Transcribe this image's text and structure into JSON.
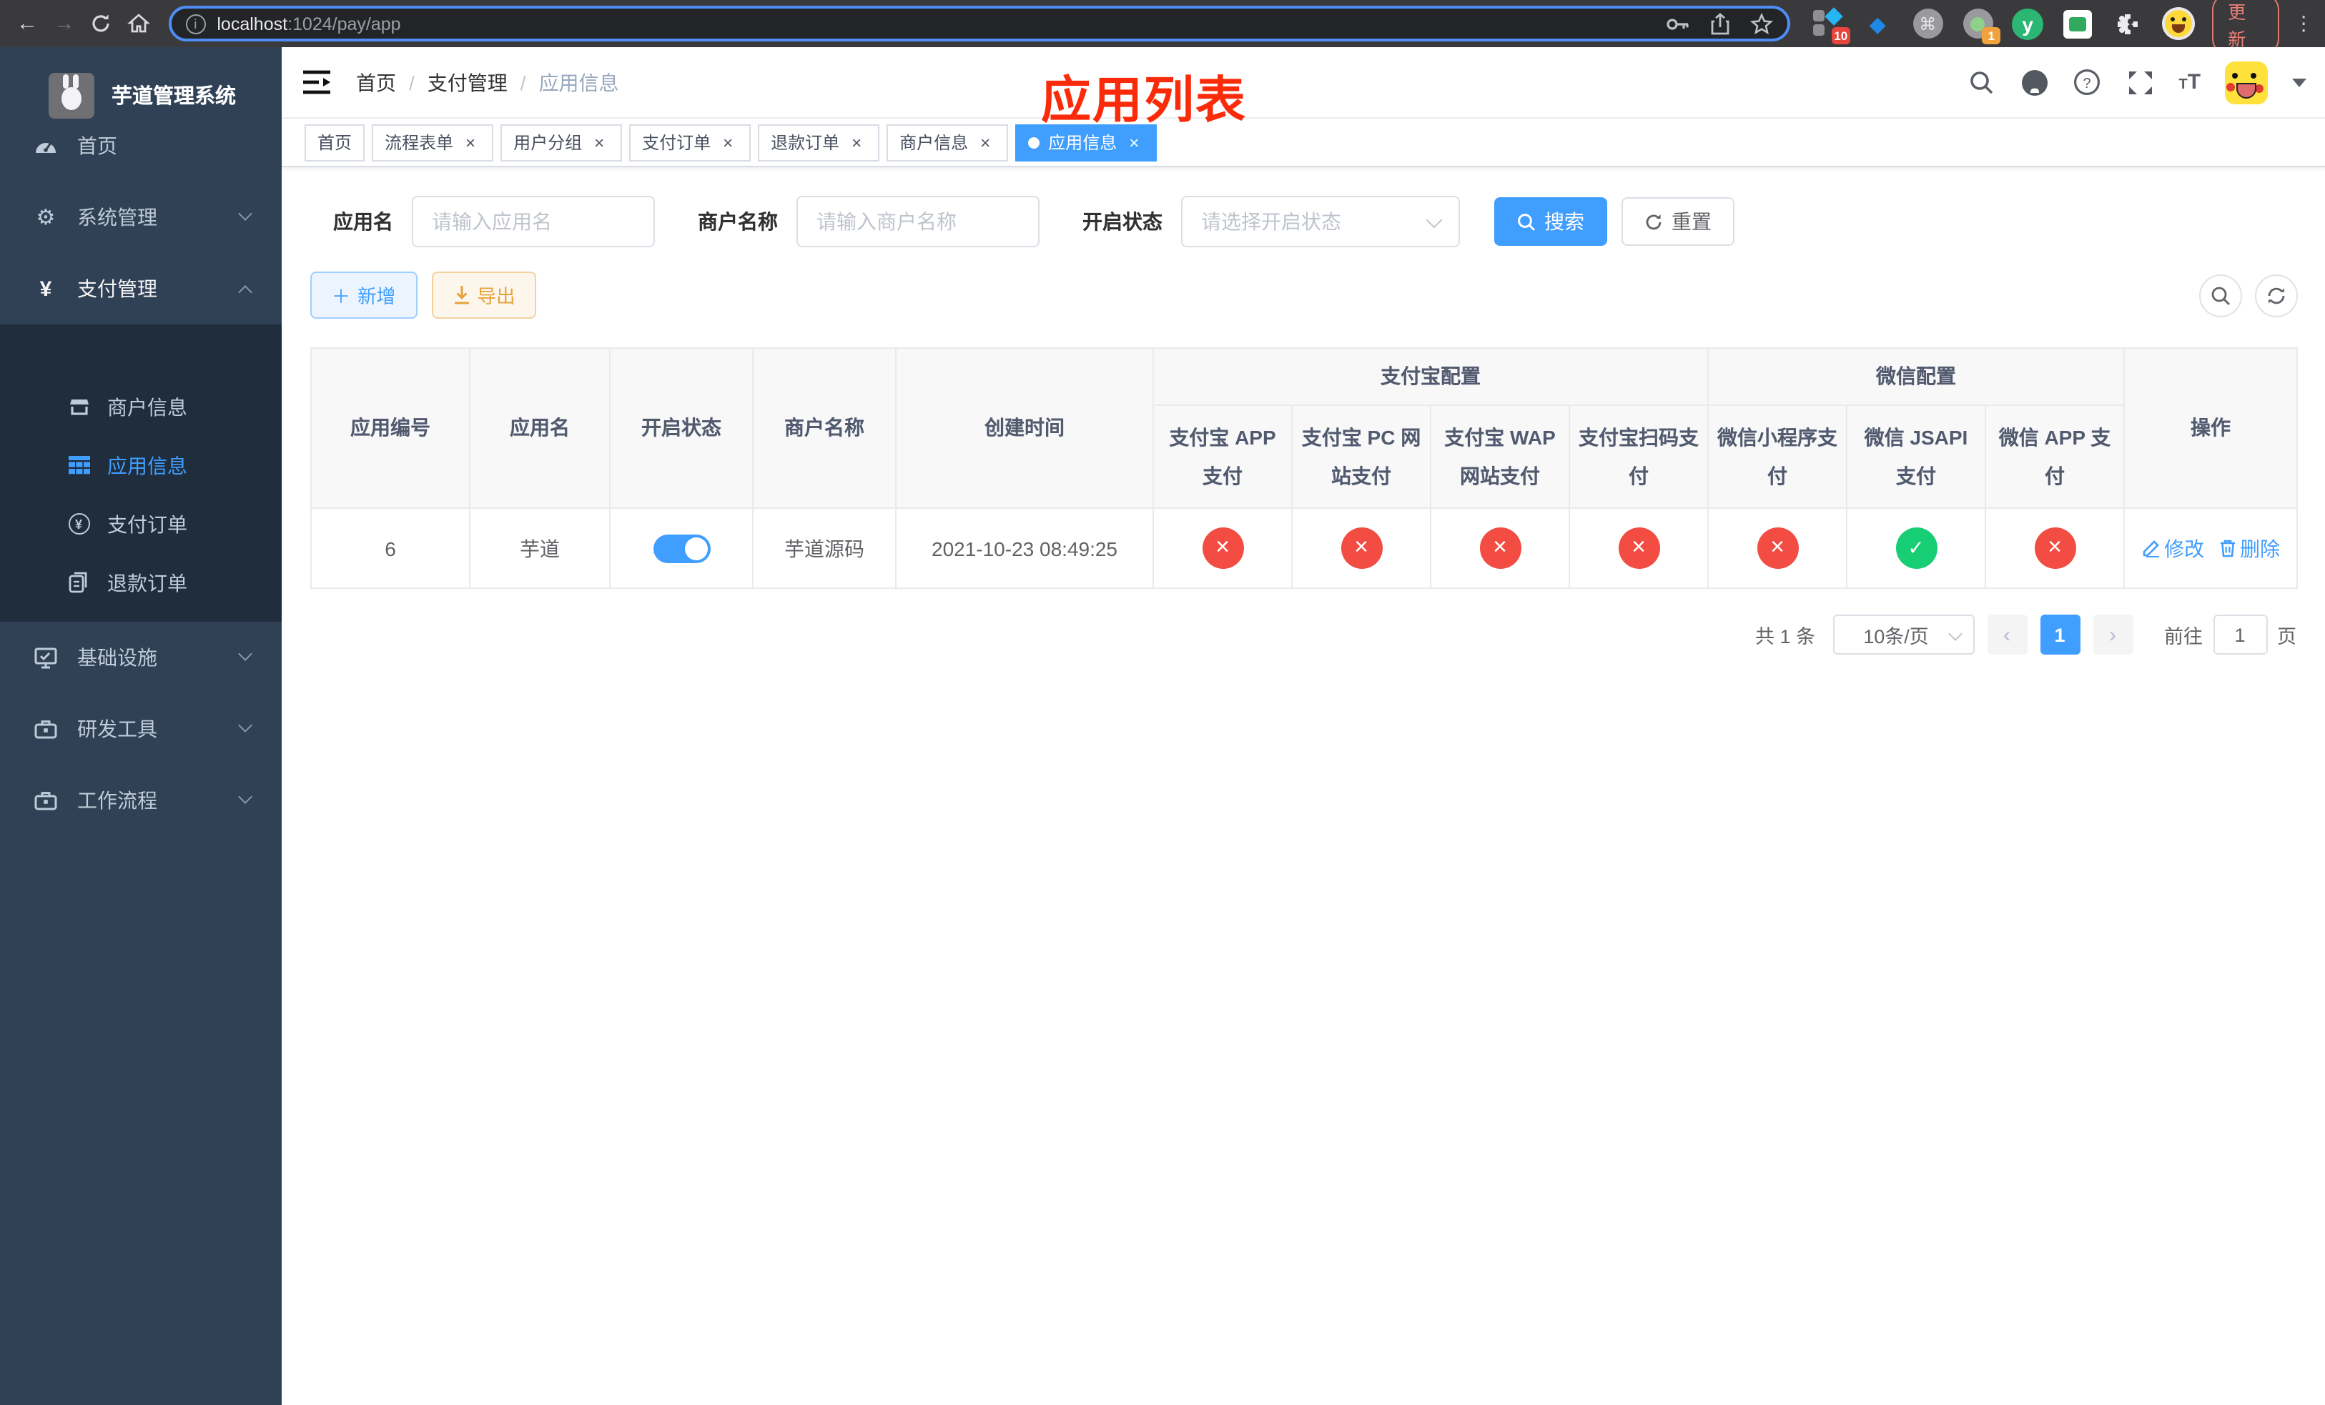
{
  "browser": {
    "url_host": "localhost",
    "url_rest": ":1024/pay/app",
    "update_label": "更新",
    "ext_badge_grid": "10",
    "ext_badge_cam": "1",
    "ext_cmd_glyph": "⌘",
    "ext_y_letter": "y"
  },
  "annotation": {
    "title": "应用列表",
    "color": "#fa2b0a"
  },
  "sidebar": {
    "app_title": "芋道管理系统",
    "items": [
      {
        "label": "首页"
      },
      {
        "label": "系统管理"
      },
      {
        "label": "支付管理"
      },
      {
        "label": "基础设施"
      },
      {
        "label": "研发工具"
      },
      {
        "label": "工作流程"
      }
    ],
    "subitems": [
      {
        "label": "商户信息"
      },
      {
        "label": "应用信息"
      },
      {
        "label": "支付订单"
      },
      {
        "label": "退款订单"
      }
    ]
  },
  "breadcrumb": {
    "items": [
      "首页",
      "支付管理",
      "应用信息"
    ],
    "separator": "/"
  },
  "tabs": [
    {
      "label": "首页"
    },
    {
      "label": "流程表单"
    },
    {
      "label": "用户分组"
    },
    {
      "label": "支付订单"
    },
    {
      "label": "退款订单"
    },
    {
      "label": "商户信息"
    },
    {
      "label": "应用信息"
    }
  ],
  "filters": {
    "app_name_label": "应用名",
    "app_name_placeholder": "请输入应用名",
    "merchant_label": "商户名称",
    "merchant_placeholder": "请输入商户名称",
    "status_label": "开启状态",
    "status_placeholder": "请选择开启状态",
    "search_button": "搜索",
    "reset_button": "重置"
  },
  "toolbar": {
    "add_button": "新增",
    "export_button": "导出"
  },
  "table": {
    "plain_headers": [
      "应用编号",
      "应用名",
      "开启状态",
      "商户名称",
      "创建时间"
    ],
    "group_headers": [
      "支付宝配置",
      "微信配置"
    ],
    "sub_headers": [
      "支付宝 APP 支付",
      "支付宝 PC 网站支付",
      "支付宝 WAP 网站支付",
      "支付宝扫码支付",
      "微信小程序支付",
      "微信 JSAPI 支付",
      "微信 APP 支付"
    ],
    "action_header": "操作",
    "rows": [
      {
        "id": "6",
        "name": "芋道",
        "enabled": "on",
        "merchant": "芋道源码",
        "created": "2021-10-23 08:49:25",
        "statuses": [
          "no",
          "no",
          "no",
          "no",
          "no",
          "yes",
          "no"
        ],
        "edit_label": "修改",
        "delete_label": "删除"
      }
    ]
  },
  "pagination": {
    "total": "共 1 条",
    "page_size": "10条/页",
    "current_page": "1",
    "goto_label": "前往",
    "goto_value": "1",
    "page_suffix": "页"
  }
}
